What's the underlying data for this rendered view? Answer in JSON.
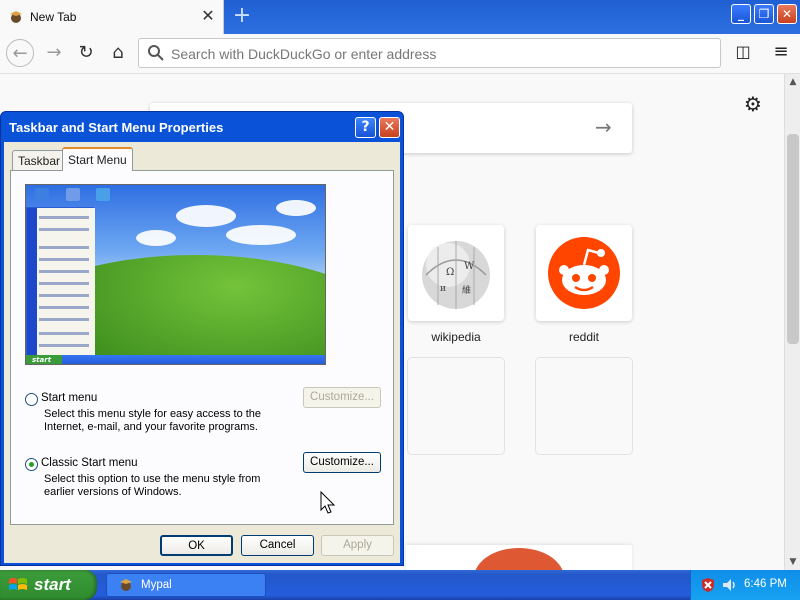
{
  "browser": {
    "tab_title": "New Tab",
    "tab_close": "✕",
    "new_tab": "+",
    "urlbar_placeholder": "Search with DuckDuckGo or enter address",
    "back": "←",
    "forward": "→",
    "reload": "↻",
    "home": "⌂",
    "sidebar": "◫",
    "menu": "≡"
  },
  "newtab": {
    "settings_icon": "⚙",
    "search_arrow": "→",
    "tiles": [
      {
        "label": "wikipedia",
        "icon": "wikipedia-icon"
      },
      {
        "label": "reddit",
        "icon": "reddit-icon"
      }
    ]
  },
  "dialog": {
    "title": "Taskbar and Start Menu Properties",
    "help": "?",
    "close": "✕",
    "tabs": [
      "Taskbar",
      "Start Menu"
    ],
    "selected_tab": "Start Menu",
    "options": [
      {
        "label": "Start menu",
        "description": [
          "Select this menu style for easy access to the",
          "Internet, e-mail, and your favorite programs."
        ],
        "selected": false,
        "button": "Customize...",
        "button_enabled": false
      },
      {
        "label": "Classic Start menu",
        "description": [
          "Select this option to use the menu style from",
          "earlier versions of Windows."
        ],
        "selected": true,
        "button": "Customize...",
        "button_enabled": true
      }
    ],
    "buttons": {
      "ok": "OK",
      "cancel": "Cancel",
      "apply": "Apply"
    },
    "preview_start": "start"
  },
  "taskbar": {
    "start": "start",
    "task_label": "Mypal",
    "clock": "6:46 PM"
  },
  "window_controls": {
    "minimize": "_",
    "maximize": "❐",
    "close": "✕"
  },
  "colors": {
    "xp_blue": "#0a53d8",
    "dialog_body": "#ece9d8",
    "start_green": "#3c9d3c",
    "reddit_orange": "#ff4500"
  }
}
